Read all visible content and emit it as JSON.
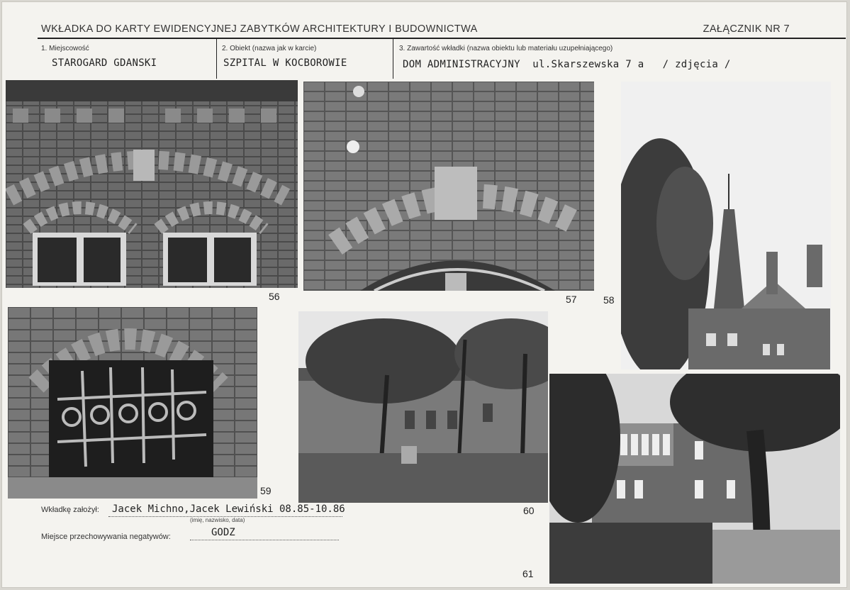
{
  "header": {
    "title": "WKŁADKA DO KARTY EWIDENCYJNEJ ZABYTKÓW ARCHITEKTURY I BUDOWNICTWA",
    "attachment": "ZAŁĄCZNIK NR 7"
  },
  "fields": {
    "locality": {
      "label": "1. Miejscowość",
      "value": "STAROGARD GDANSKI"
    },
    "object": {
      "label": "2. Obiekt (nazwa jak w karcie)",
      "value": "SZPITAL W KOCBOROWIE"
    },
    "content": {
      "label": "3. Zawartość wkładki (nazwa obiektu lub materiału uzupełniającego)",
      "value": "DOM ADMINISTRACYJNY  ul.Skarszewska 7 a   / zdjęcia /"
    }
  },
  "photos": [
    {
      "number": "56",
      "subject": "brick facade with arched windows"
    },
    {
      "number": "57",
      "subject": "arched window with keystone"
    },
    {
      "number": "58",
      "subject": "tower with spire behind trees"
    },
    {
      "number": "59",
      "subject": "arched basement window with iron grille"
    },
    {
      "number": "60",
      "subject": "building behind trees and fence"
    },
    {
      "number": "61",
      "subject": "villa with veranda and large tree"
    }
  ],
  "footer": {
    "founded_label": "Wkładkę założył:",
    "founded_value": "Jacek Michno,Jacek Lewiński 08.85-10.86",
    "founded_hint": "(imię, nazwisko, data)",
    "storage_label": "Miejsce przechowywania negatywów:",
    "storage_value": "GODZ"
  },
  "colors": {
    "paper": "#f4f3ef",
    "ink": "#222222"
  }
}
